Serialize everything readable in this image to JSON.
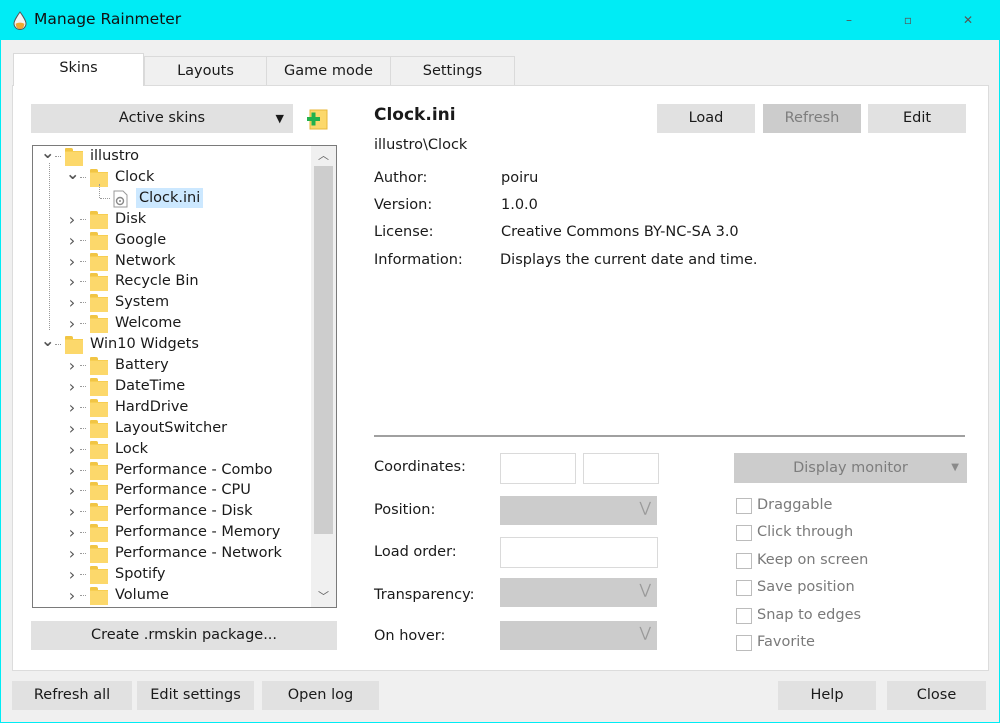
{
  "window": {
    "title": "Manage Rainmeter",
    "controls": {
      "minimize": "–",
      "maximize": "▫",
      "close": "✕"
    }
  },
  "tabs": [
    {
      "label": "Skins",
      "active": true
    },
    {
      "label": "Layouts",
      "active": false
    },
    {
      "label": "Game mode",
      "active": false
    },
    {
      "label": "Settings",
      "active": false
    }
  ],
  "skins_panel": {
    "dropdown_label": "Active skins",
    "create_package_label": "Create .rmskin package...",
    "tree": {
      "groups": [
        {
          "name": "illustro",
          "expanded": true,
          "children": [
            {
              "name": "Clock",
              "expanded": true,
              "files": [
                "Clock.ini"
              ]
            },
            {
              "name": "Disk"
            },
            {
              "name": "Google"
            },
            {
              "name": "Network"
            },
            {
              "name": "Recycle Bin"
            },
            {
              "name": "System"
            },
            {
              "name": "Welcome"
            }
          ]
        },
        {
          "name": "Win10 Widgets",
          "expanded": true,
          "children": [
            {
              "name": "Battery"
            },
            {
              "name": "DateTime"
            },
            {
              "name": "HardDrive"
            },
            {
              "name": "LayoutSwitcher"
            },
            {
              "name": "Lock"
            },
            {
              "name": "Performance - Combo"
            },
            {
              "name": "Performance - CPU"
            },
            {
              "name": "Performance - Disk"
            },
            {
              "name": "Performance - Memory"
            },
            {
              "name": "Performance - Network"
            },
            {
              "name": "Spotify"
            },
            {
              "name": "Volume"
            }
          ]
        }
      ],
      "selected": "Clock.ini"
    }
  },
  "details": {
    "skin_name": "Clock.ini",
    "skin_path": "illustro\\Clock",
    "buttons": {
      "load": "Load",
      "refresh": "Refresh",
      "edit": "Edit"
    },
    "metadata": [
      {
        "label": "Author:",
        "value": "poiru"
      },
      {
        "label": "Version:",
        "value": "1.0.0"
      },
      {
        "label": "License:",
        "value": "Creative Commons BY-NC-SA 3.0"
      },
      {
        "label": "Information:",
        "value": "Displays the current date and time."
      }
    ],
    "settings": {
      "coordinates_label": "Coordinates:",
      "position_label": "Position:",
      "load_order_label": "Load order:",
      "transparency_label": "Transparency:",
      "on_hover_label": "On hover:",
      "display_monitor_label": "Display monitor",
      "checkboxes": [
        {
          "label": "Draggable",
          "checked": false
        },
        {
          "label": "Click through",
          "checked": false
        },
        {
          "label": "Keep on screen",
          "checked": false
        },
        {
          "label": "Save position",
          "checked": false
        },
        {
          "label": "Snap to edges",
          "checked": false
        },
        {
          "label": "Favorite",
          "checked": false
        }
      ]
    }
  },
  "footer": {
    "refresh_all": "Refresh all",
    "edit_settings": "Edit settings",
    "open_log": "Open log",
    "help": "Help",
    "close": "Close"
  },
  "colors": {
    "window_frame": "#00ecf5",
    "button": "#e1e1e1",
    "disabled": "#cccccc",
    "selection": "#cce8ff",
    "add_icon": "#22b14c"
  }
}
